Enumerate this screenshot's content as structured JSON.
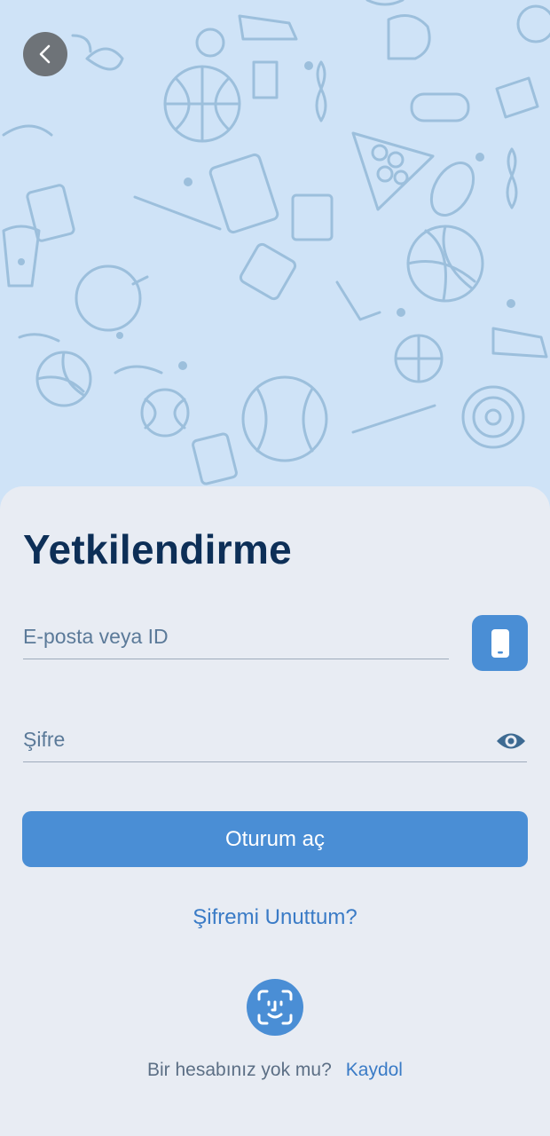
{
  "header": {
    "back_icon": "chevron-left-icon"
  },
  "hero": {
    "pattern": "sports-doodle-pattern"
  },
  "auth": {
    "title": "Yetkilendirme",
    "email_placeholder": "E-posta veya ID",
    "password_placeholder": "Şifre",
    "login_label": "Oturum aç",
    "forgot_label": "Şifremi Unuttum?",
    "no_account_text": "Bir hesabınız yok mu?",
    "signup_label": "Kaydol"
  },
  "colors": {
    "accent": "#4a8ed5",
    "title": "#0d2f57",
    "link": "#3a7bc6",
    "hero_bg": "#cfe3f7",
    "sheet_bg": "#e8ecf3"
  },
  "icons": [
    "chevron-left-icon",
    "phone-icon",
    "eye-icon",
    "face-id-icon"
  ]
}
